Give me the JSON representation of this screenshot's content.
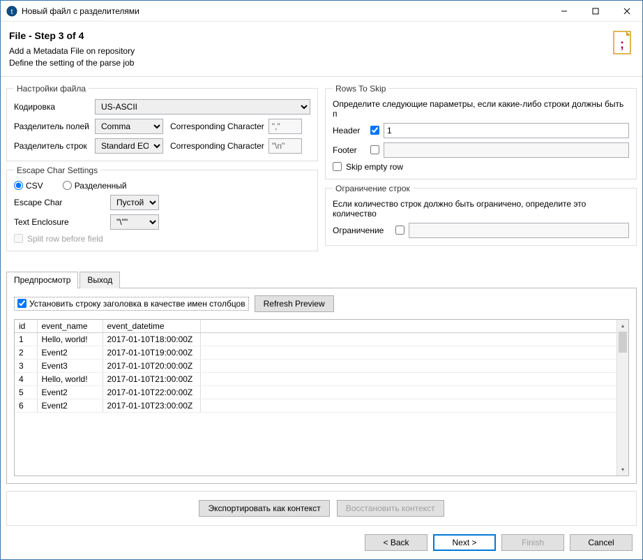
{
  "window": {
    "title": "Новый файл с разделителями"
  },
  "header": {
    "title": "File - Step 3 of 4",
    "line1": "Add a Metadata File on repository",
    "line2": "Define the setting of the parse job"
  },
  "fileSettings": {
    "legend": "Настройки файла",
    "encodingLabel": "Кодировка",
    "encoding": "US-ASCII",
    "fieldSepLabel": "Разделитель полей",
    "fieldSep": "Comma",
    "correspLabel": "Corresponding Character",
    "fieldSepChar": "\",\"",
    "rowSepLabel": "Разделитель строк",
    "rowSep": "Standard EOL",
    "rowSepChar": "\"\\n\""
  },
  "escapeSettings": {
    "legend": "Escape Char Settings",
    "csvRadio": "CSV",
    "delimitedRadio": "Разделенный",
    "escapeCharLabel": "Escape Char",
    "escapeChar": "Пустой",
    "textEnclosureLabel": "Text Enclosure",
    "textEnclosure": "\"\\\"\"",
    "splitRowLabel": "Split row before field"
  },
  "rowsToSkip": {
    "legend": "Rows To Skip",
    "desc": "Определите следующие параметры, если какие-либо строки должны быть п",
    "headerLabel": "Header",
    "headerValue": "1",
    "footerLabel": "Footer",
    "footerValue": "",
    "skipEmptyLabel": "Skip empty row"
  },
  "rowLimit": {
    "legend": "Ограничение строк",
    "desc": "Если количество строк должно быть ограничено, определите это количество",
    "limitLabel": "Ограничение",
    "limitValue": ""
  },
  "tabs": {
    "preview": "Предпросмотр",
    "output": "Выход"
  },
  "preview": {
    "headerRowCheckLabel": "Установить строку заголовка в качестве имен столбцов",
    "refreshBtn": "Refresh Preview",
    "columns": [
      "id",
      "event_name",
      "event_datetime"
    ],
    "rows": [
      {
        "id": "1",
        "event_name": "Hello, world!",
        "event_datetime": "2017-01-10T18:00:00Z"
      },
      {
        "id": "2",
        "event_name": "Event2",
        "event_datetime": "2017-01-10T19:00:00Z"
      },
      {
        "id": "3",
        "event_name": "Event3",
        "event_datetime": "2017-01-10T20:00:00Z"
      },
      {
        "id": "4",
        "event_name": "Hello, world!",
        "event_datetime": "2017-01-10T21:00:00Z"
      },
      {
        "id": "5",
        "event_name": "Event2",
        "event_datetime": "2017-01-10T22:00:00Z"
      },
      {
        "id": "6",
        "event_name": "Event2",
        "event_datetime": "2017-01-10T23:00:00Z"
      }
    ]
  },
  "contextBar": {
    "exportBtn": "Экспортировать как контекст",
    "restoreBtn": "Восстановить контекст"
  },
  "wizard": {
    "back": "< Back",
    "next": "Next >",
    "finish": "Finish",
    "cancel": "Cancel"
  }
}
